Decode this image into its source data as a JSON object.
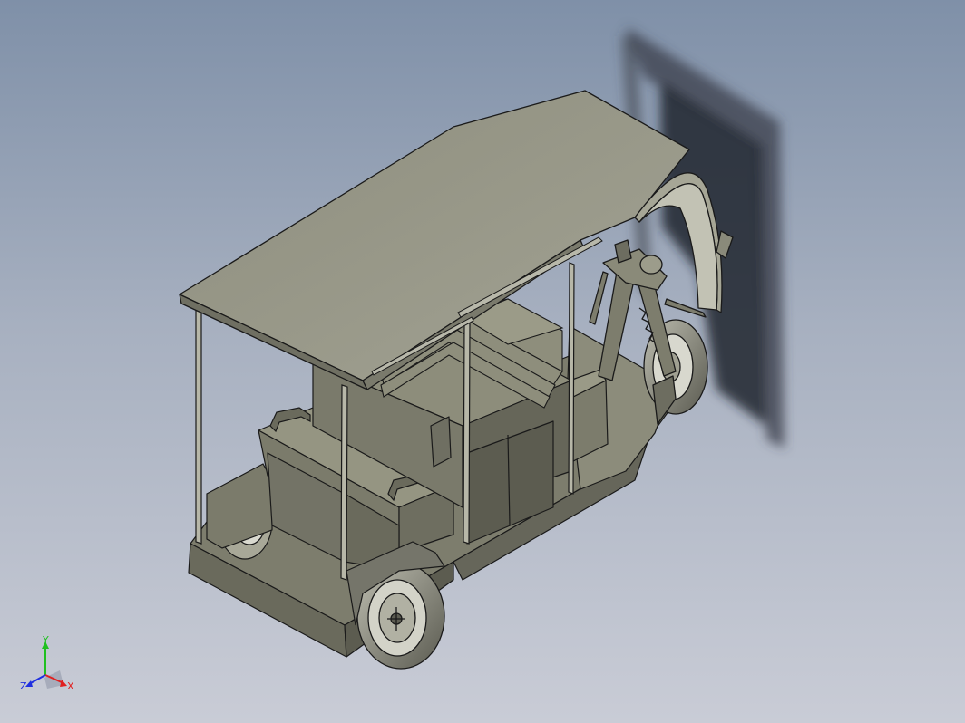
{
  "viewport": {
    "background_top": "#7f90a8",
    "background_bottom": "#c9ccd6"
  },
  "model": {
    "body_color": "#8f8f7a",
    "edge_color": "#1a1a1a"
  },
  "triad": {
    "x_label": "X",
    "y_label": "Y",
    "z_label": "Z",
    "x_color": "#e02020",
    "y_color": "#20c020",
    "z_color": "#2030e0"
  }
}
